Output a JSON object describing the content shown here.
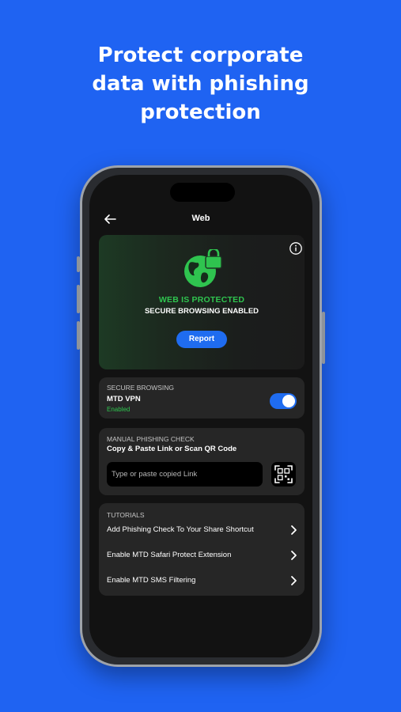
{
  "promo": {
    "line1": "Protect corporate",
    "line2": "data with phishing",
    "line3": "protection"
  },
  "nav": {
    "title": "Web",
    "back_icon": "arrow-left-icon"
  },
  "hero": {
    "status": "WEB IS PROTECTED",
    "subtitle": "SECURE BROWSING ENABLED",
    "report_label": "Report",
    "icon": "globe-lock-icon",
    "info_icon": "info-icon"
  },
  "secure_browsing": {
    "section_label": "SECURE BROWSING",
    "title": "MTD VPN",
    "state": "Enabled",
    "toggle_on": true
  },
  "phishing_check": {
    "section_label": "MANUAL PHISHING CHECK",
    "title": "Copy & Paste Link or Scan QR Code",
    "input_placeholder": "Type or paste copied Link",
    "qr_icon": "qr-scan-icon"
  },
  "tutorials": {
    "section_label": "TUTORIALS",
    "items": [
      {
        "label": "Add Phishing Check To Your Share Shortcut"
      },
      {
        "label": "Enable MTD Safari Protect Extension"
      },
      {
        "label": "Enable MTD SMS Filtering"
      }
    ]
  },
  "colors": {
    "background": "#1f63f2",
    "accent": "#1f6cf0",
    "success": "#2fc44f",
    "card": "#262626",
    "screen": "#121212"
  }
}
